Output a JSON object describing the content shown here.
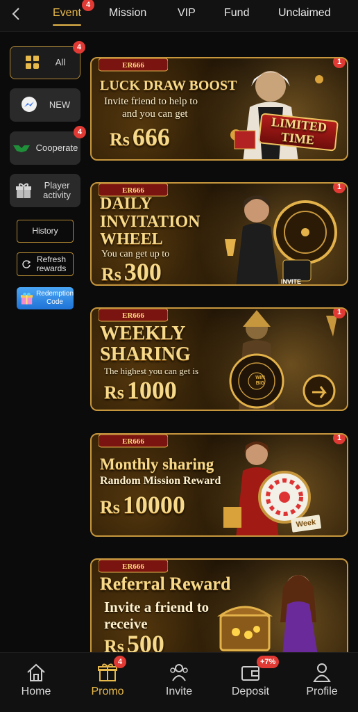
{
  "tabs": [
    {
      "label": "Event",
      "badge": "4",
      "active": true
    },
    {
      "label": "Mission"
    },
    {
      "label": "VIP"
    },
    {
      "label": "Fund"
    },
    {
      "label": "Unclaimed"
    }
  ],
  "sidebar": {
    "items": [
      {
        "label": "All",
        "badge": "4",
        "icon": "grid-icon"
      },
      {
        "label": "NEW",
        "icon": "messenger-icon"
      },
      {
        "label": "Cooperate",
        "badge": "4",
        "icon": "handshake-icon"
      },
      {
        "label": "Player activity",
        "icon": "gift-icon"
      }
    ],
    "history_label": "History",
    "refresh_label": "Refresh rewards",
    "redemption_label": "Redemption Code"
  },
  "banners": [
    {
      "badge": "1",
      "logo": "ER666",
      "title": "LUCK DRAW BOOST",
      "subtitle_1": "Invite friend to help to",
      "subtitle_2": "and you can get",
      "currency": "Rs",
      "amount": "666",
      "tag": "LIMITED TIME"
    },
    {
      "badge": "1",
      "logo": "ER666",
      "title_1": "DAILY",
      "title_2": "INVITATION",
      "title_3": "WHEEL",
      "subtitle": "You can get up to",
      "currency": "Rs",
      "amount": "300",
      "tag": "INVITE"
    },
    {
      "badge": "1",
      "logo": "ER666",
      "title_1": "WEEKLY",
      "title_2": "SHARING",
      "subtitle": "The highest you can get is",
      "currency": "Rs",
      "amount": "1000",
      "wheel_text": "WIN BIG"
    },
    {
      "badge": "1",
      "logo": "ER666",
      "title": "Monthly sharing",
      "subtitle": "Random Mission Reward",
      "currency": "Rs",
      "amount": "10000",
      "tag": "Week"
    },
    {
      "logo": "ER666",
      "title": "Referral Reward",
      "subtitle_1": "Invite a friend to",
      "subtitle_2": "receive",
      "currency": "Rs",
      "amount": "500"
    }
  ],
  "bottom_nav": [
    {
      "label": "Home",
      "icon": "home-icon"
    },
    {
      "label": "Promo",
      "icon": "gift-icon",
      "badge": "4",
      "active": true
    },
    {
      "label": "Invite",
      "icon": "people-icon"
    },
    {
      "label": "Deposit",
      "icon": "wallet-icon",
      "badge": "+7%"
    },
    {
      "label": "Profile",
      "icon": "user-icon"
    }
  ],
  "colors": {
    "accent": "#e7b84a",
    "badge": "#e13a34",
    "border_gold": "#c7973e",
    "background": "#0b0b0b"
  }
}
